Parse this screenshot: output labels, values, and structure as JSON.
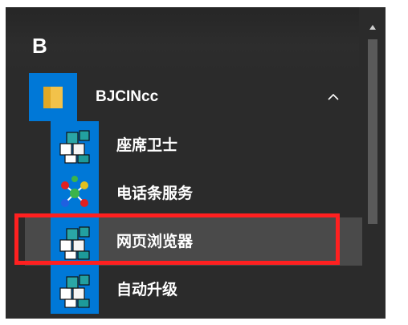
{
  "section_letter": "B",
  "group": {
    "label": "BJCINcc",
    "icon": "folder-icon",
    "expanded": true
  },
  "items": [
    {
      "label": "座席卫士",
      "icon": "app-cubes-icon"
    },
    {
      "label": "电话条服务",
      "icon": "app-molecule-icon"
    },
    {
      "label": "网页浏览器",
      "icon": "app-cubes-icon",
      "highlighted": true
    },
    {
      "label": "自动升级",
      "icon": "app-cubes-icon"
    }
  ],
  "colors": {
    "menu_bg": "#2b2b2b",
    "tile_blue": "#0078d7",
    "hover_bg": "#4a4a4a",
    "highlight_red": "#ff2020"
  }
}
